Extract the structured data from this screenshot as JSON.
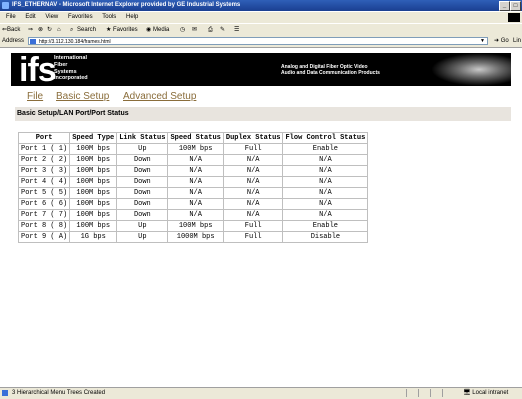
{
  "window": {
    "title": "IFS_ETHERNAV - Microsoft Internet Explorer provided by GE Industrial Systems",
    "min_label": "_",
    "max_label": "□"
  },
  "menubar": {
    "items": [
      "File",
      "Edit",
      "View",
      "Favorites",
      "Tools",
      "Help"
    ]
  },
  "toolbar": {
    "back": "⇐Back",
    "forward": "⇒",
    "search": "Search",
    "favorites": "Favorites",
    "media": "Media"
  },
  "addressbar": {
    "label": "Address",
    "url": "http://3.112.130.184/frames.html",
    "go": "Go",
    "links": "Lin"
  },
  "banner": {
    "logo": "ifs",
    "company": [
      "International",
      "Fiber",
      "Systems",
      "Incorporated"
    ],
    "tagline": [
      "Analog and Digital Fiber Optic Video",
      "Audio and Data Communication Products"
    ]
  },
  "nav": {
    "items": [
      "File",
      "Basic Setup",
      "Advanced Setup"
    ]
  },
  "page": {
    "heading": "Basic Setup/LAN Port/Port Status"
  },
  "port_table": {
    "headers": [
      "Port",
      "Speed Type",
      "Link Status",
      "Speed Status",
      "Duplex Status",
      "Flow Control Status"
    ],
    "rows": [
      [
        "Port 1 ( 1)",
        "100M bps",
        "Up",
        "100M bps",
        "Full",
        "Enable"
      ],
      [
        "Port 2 ( 2)",
        "100M bps",
        "Down",
        "N/A",
        "N/A",
        "N/A"
      ],
      [
        "Port 3 ( 3)",
        "100M bps",
        "Down",
        "N/A",
        "N/A",
        "N/A"
      ],
      [
        "Port 4 ( 4)",
        "100M bps",
        "Down",
        "N/A",
        "N/A",
        "N/A"
      ],
      [
        "Port 5 ( 5)",
        "100M bps",
        "Down",
        "N/A",
        "N/A",
        "N/A"
      ],
      [
        "Port 6 ( 6)",
        "100M bps",
        "Down",
        "N/A",
        "N/A",
        "N/A"
      ],
      [
        "Port 7 ( 7)",
        "100M bps",
        "Down",
        "N/A",
        "N/A",
        "N/A"
      ],
      [
        "Port 8 ( 8)",
        "100M bps",
        "Up",
        "100M bps",
        "Full",
        "Enable"
      ],
      [
        "Port 9 ( A)",
        "1G bps",
        "Up",
        "1000M bps",
        "Full",
        "Disable"
      ]
    ]
  },
  "statusbar": {
    "text": "3 Hierarchical Menu Trees Created",
    "zone": "Local intranet"
  }
}
